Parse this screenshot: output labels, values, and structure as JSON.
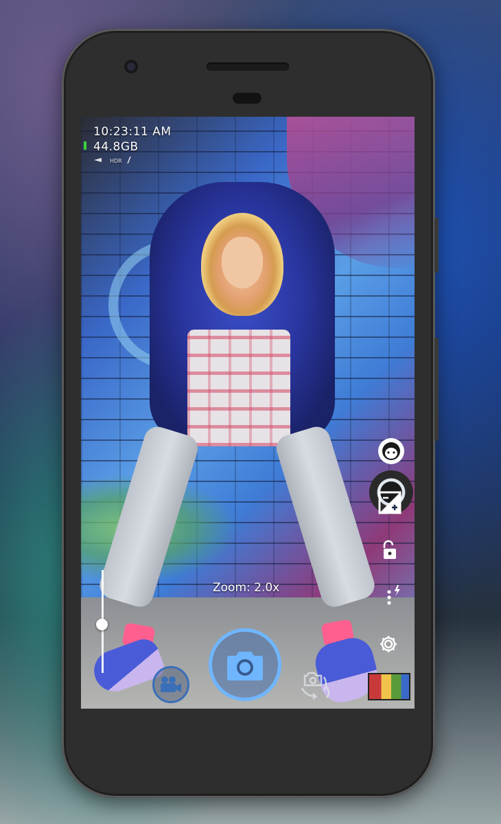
{
  "status": {
    "time": "10:23:11 AM",
    "storage": "44.8GB",
    "mini_icons": [
      "flashlight",
      "HDR",
      "exposure"
    ]
  },
  "viewfinder": {
    "zoom_label": "Zoom: 2.0x",
    "zoom_level": 2.0
  },
  "controls": {
    "right_side": [
      "face-detection-icon",
      "exposure-compensation-icon",
      "exposure-lock-icon",
      "flash-icon",
      "settings-icon"
    ],
    "bottom": [
      "video-camera-icon",
      "shutter-camera-icon",
      "switch-camera-icon",
      "gallery-thumbnail"
    ]
  },
  "colors": {
    "shutter_ring": "#6fb6ff",
    "video_ring": "#3a6fb8",
    "storage_indicator": "#3ad13a"
  }
}
